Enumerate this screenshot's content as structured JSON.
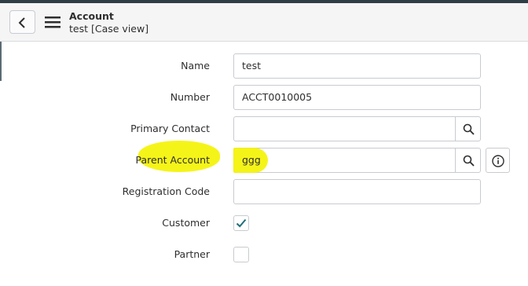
{
  "header": {
    "title": "Account",
    "subtitle": "test [Case view]",
    "back_icon": "chevron-left-icon",
    "menu_icon": "hamburger-menu-icon"
  },
  "form": {
    "name": {
      "label": "Name",
      "value": "test"
    },
    "number": {
      "label": "Number",
      "value": "ACCT0010005"
    },
    "primary_contact": {
      "label": "Primary Contact",
      "value": "",
      "lookup_icon": "search-icon"
    },
    "parent_account": {
      "label": "Parent Account",
      "value": "ggg",
      "lookup_icon": "search-icon",
      "info_icon": "info-icon"
    },
    "registration_code": {
      "label": "Registration Code",
      "value": ""
    },
    "customer": {
      "label": "Customer",
      "checked": true
    },
    "partner": {
      "label": "Partner",
      "checked": false
    }
  },
  "colors": {
    "highlight": "#f4f300",
    "check": "#1f6f7a",
    "top_strip": "#2f3e46"
  }
}
